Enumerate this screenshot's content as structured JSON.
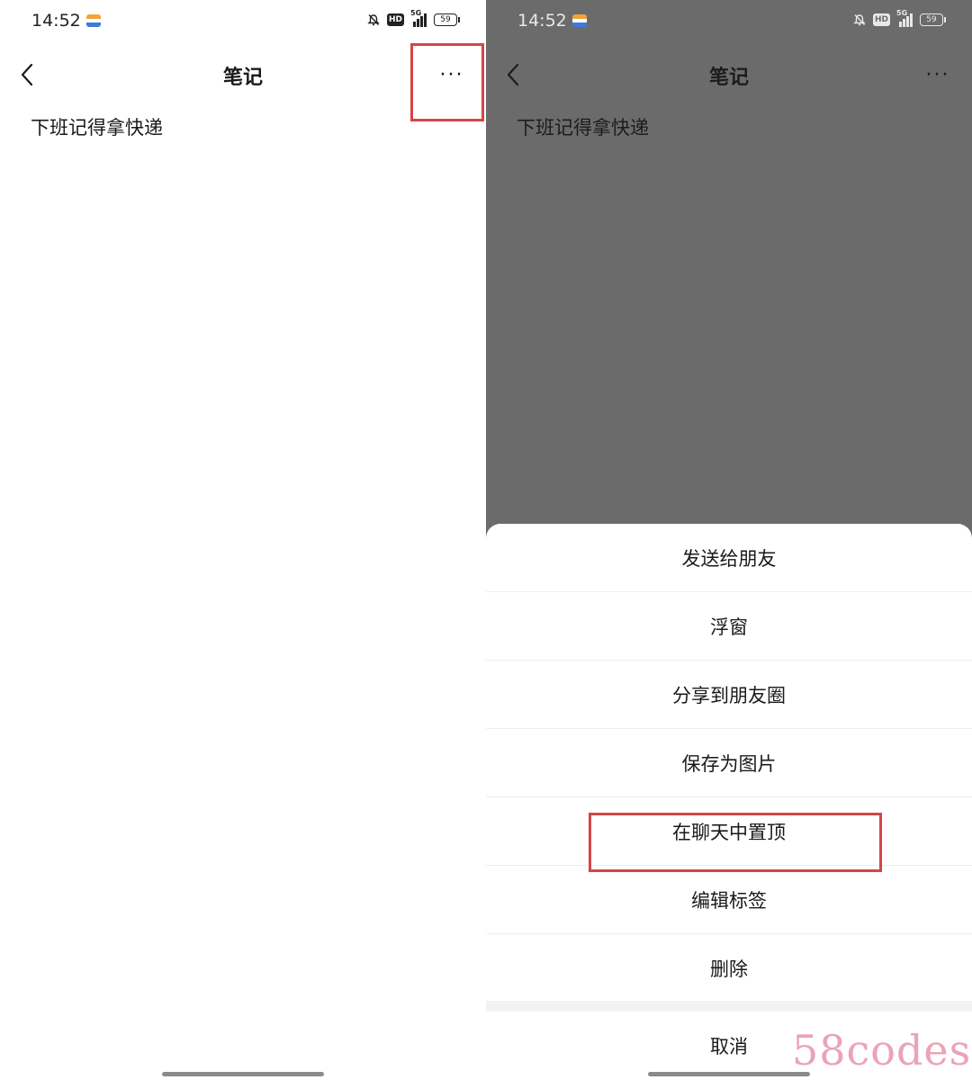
{
  "status": {
    "time": "14:52",
    "hd": "HD",
    "network": "5G",
    "battery": "59",
    "icons": [
      "app-notification-icon",
      "mute-bell-icon",
      "signal-icon",
      "battery-icon"
    ]
  },
  "left_screen": {
    "nav_title": "笔记",
    "more_label": "···",
    "note_content": "下班记得拿快递"
  },
  "right_screen": {
    "nav_title": "笔记",
    "more_label": "···",
    "note_content": "下班记得拿快递",
    "menu_items": [
      "发送给朋友",
      "浮窗",
      "分享到朋友圈",
      "保存为图片",
      "在聊天中置顶",
      "编辑标签",
      "删除"
    ],
    "cancel_label": "取消"
  },
  "annotation_color": "#d64545",
  "watermark": "58codes"
}
